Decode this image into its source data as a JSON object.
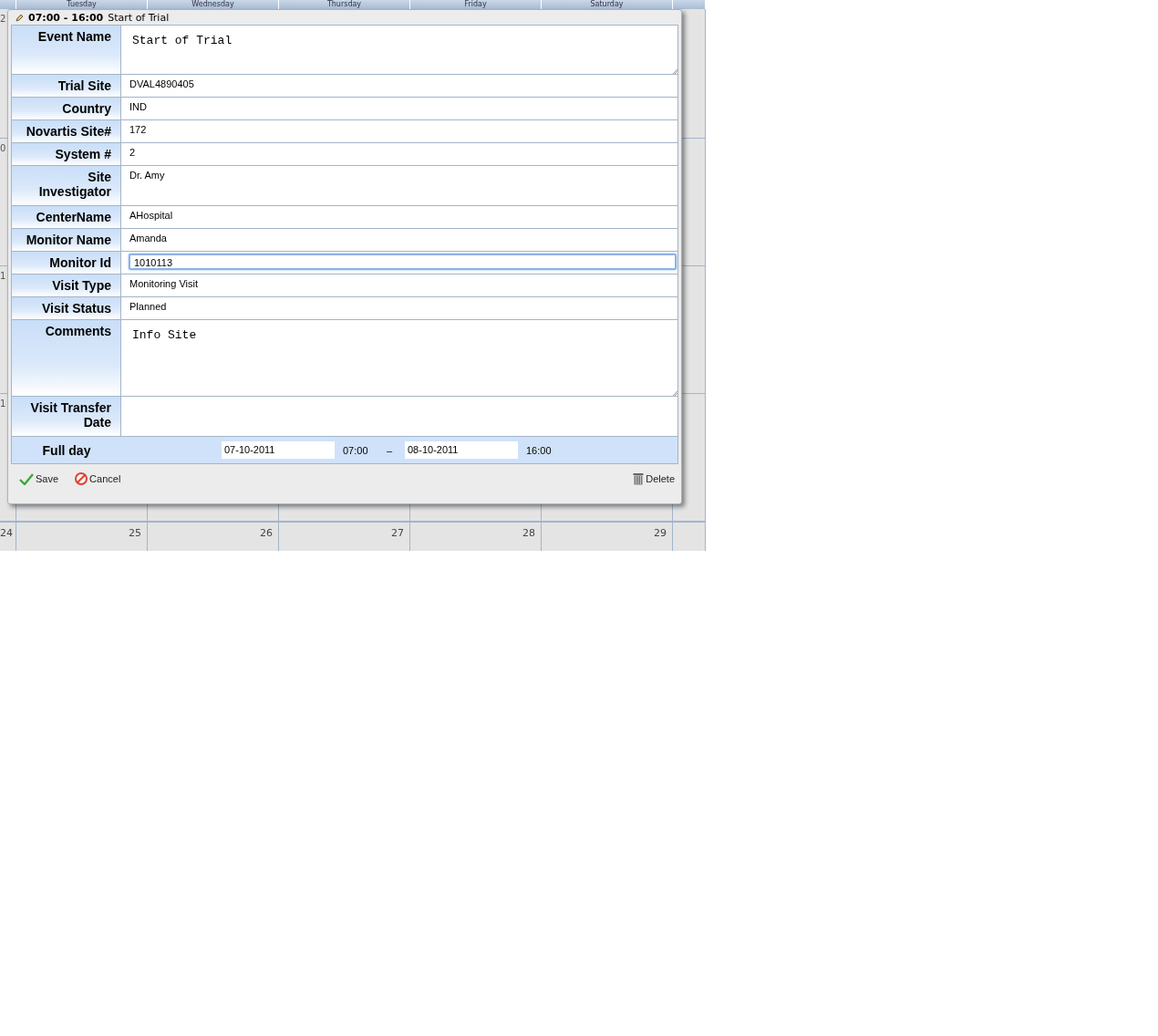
{
  "calendar": {
    "day_headers": [
      "Tuesday",
      "Wednesday",
      "Thursday",
      "Friday",
      "Saturday"
    ],
    "cut_column_marks": [
      "2",
      "0",
      "1",
      "1"
    ],
    "last_row_dates": [
      "24",
      "25",
      "26",
      "27",
      "28",
      "29"
    ]
  },
  "dialog": {
    "title_time": "07:00 - 16:00",
    "title_text": "Start of Trial",
    "fields": [
      {
        "label": "Event Name",
        "value": "Start of Trial",
        "kind": "textarea",
        "focused": false
      },
      {
        "label": "Trial Site",
        "value": "DVAL4890405",
        "kind": "text",
        "focused": false
      },
      {
        "label": "Country",
        "value": "IND",
        "kind": "text",
        "focused": false
      },
      {
        "label": "Novartis Site#",
        "value": "172",
        "kind": "text",
        "focused": false
      },
      {
        "label": "System #",
        "value": "2",
        "kind": "text",
        "focused": false
      },
      {
        "label": "Site Investigator",
        "value": "Dr. Amy",
        "kind": "tall",
        "focused": false
      },
      {
        "label": "CenterName",
        "value": "AHospital",
        "kind": "text",
        "focused": false
      },
      {
        "label": "Monitor Name",
        "value": "Amanda",
        "kind": "text",
        "focused": false
      },
      {
        "label": "Monitor Id",
        "value": "1010113",
        "kind": "input",
        "focused": true
      },
      {
        "label": "Visit Type",
        "value": "Monitoring Visit",
        "kind": "text",
        "focused": false
      },
      {
        "label": "Visit Status",
        "value": "Planned",
        "kind": "text",
        "focused": false
      },
      {
        "label": "Comments",
        "value": "Info Site",
        "kind": "textarea_large",
        "focused": false
      },
      {
        "label": "Visit Transfer Date",
        "kind": "tall",
        "focused": false
      }
    ],
    "full_day": {
      "label": "Full day",
      "start_date": "07-10-2011",
      "start_time": "07:00",
      "separator": "–",
      "end_date": "08-10-2011",
      "end_time": "16:00"
    },
    "buttons": {
      "save": "Save",
      "cancel": "Cancel",
      "delete": "Delete"
    }
  }
}
